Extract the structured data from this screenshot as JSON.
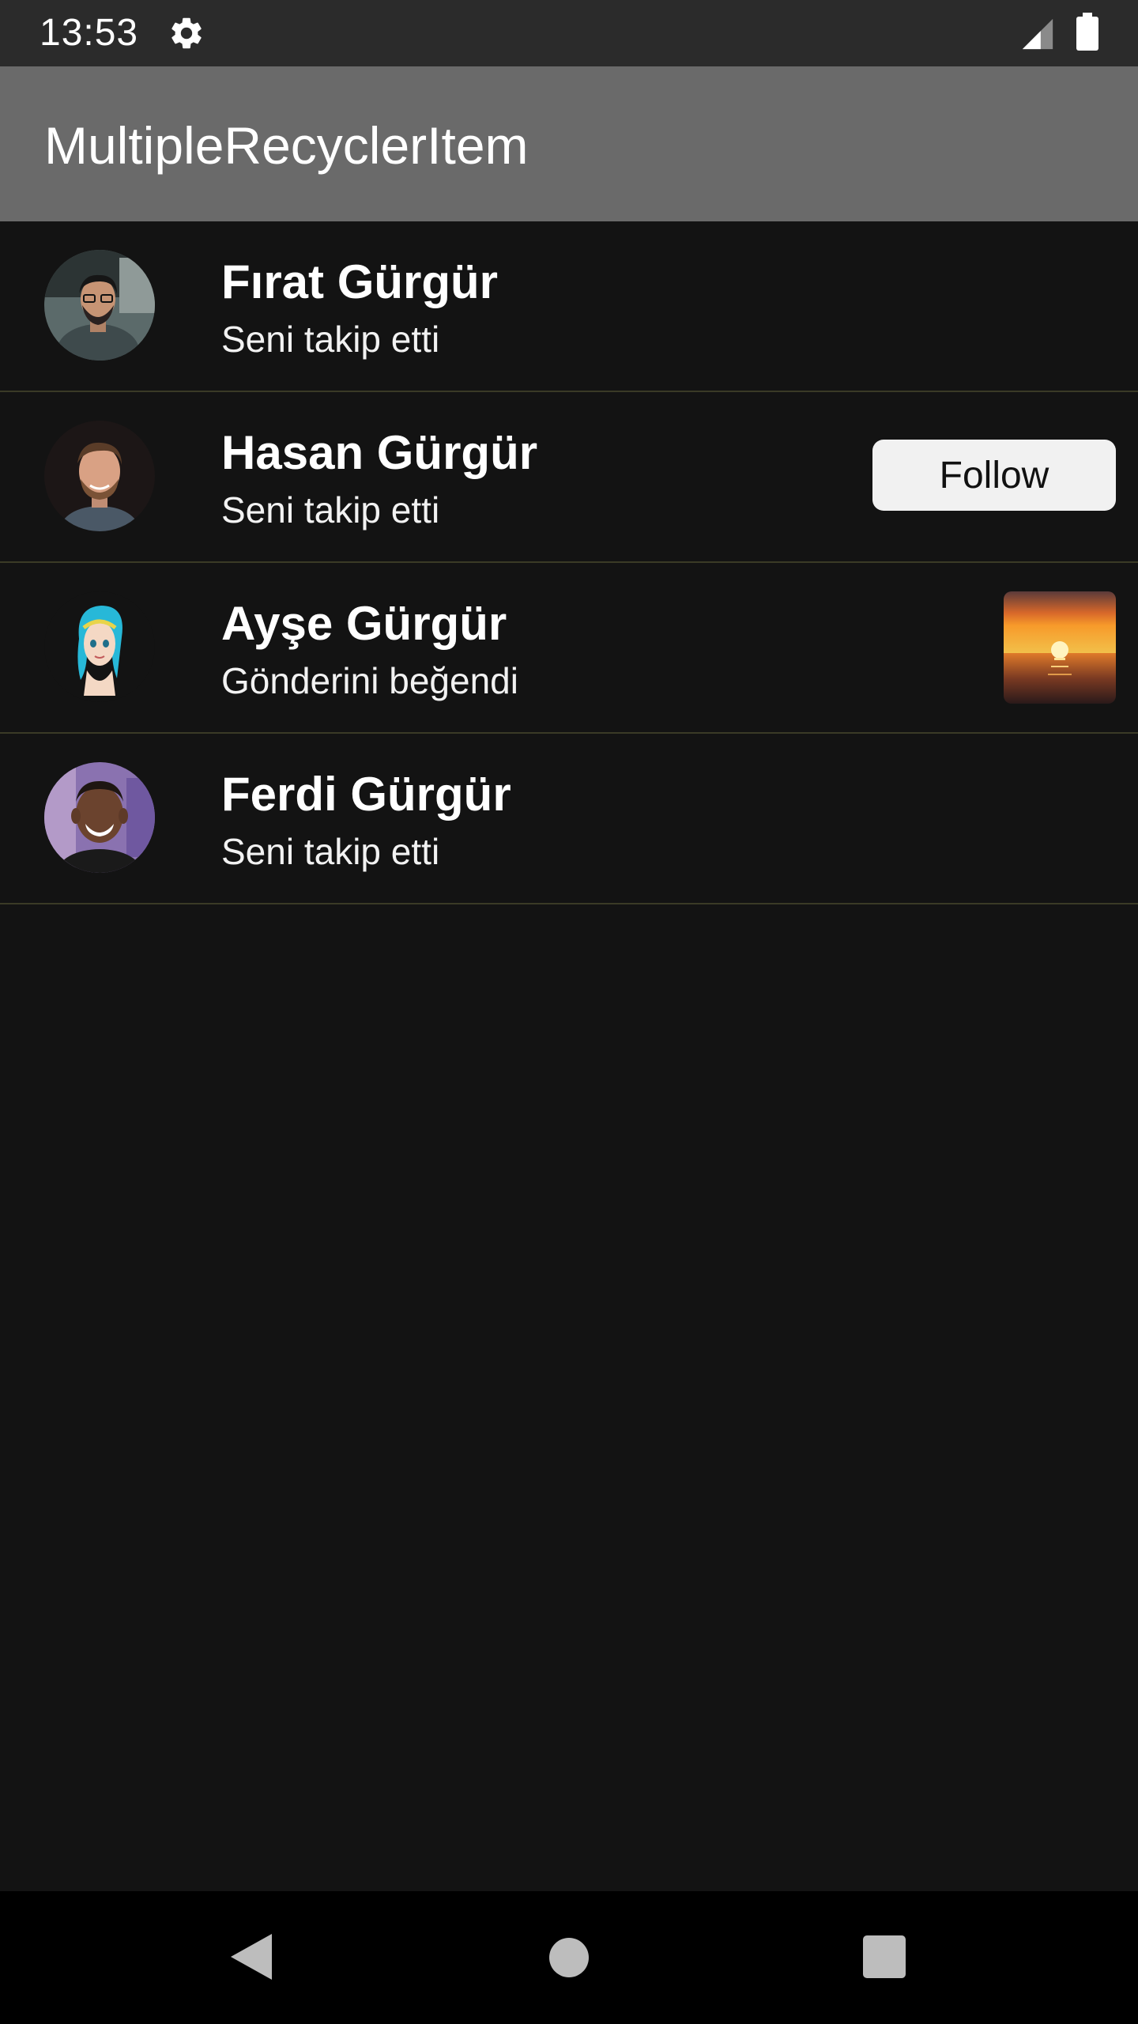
{
  "status_bar": {
    "time": "13:53",
    "icons": [
      "gear-icon",
      "signal-icon",
      "battery-icon"
    ]
  },
  "app_bar": {
    "title": "MultipleRecyclerItem"
  },
  "list": {
    "items": [
      {
        "name": "Fırat Gürgür",
        "subtitle": "Seni takip etti",
        "avatar": "avatar-man-glasses",
        "action": null
      },
      {
        "name": "Hasan Gürgür",
        "subtitle": "Seni takip etti",
        "avatar": "avatar-man-beard",
        "action": "Follow"
      },
      {
        "name": "Ayşe Gürgür",
        "subtitle": "Gönderini beğendi",
        "avatar": "avatar-cartoon-girl",
        "action": "post-thumbnail-sunset"
      },
      {
        "name": "Ferdi Gürgür",
        "subtitle": "Seni takip etti",
        "avatar": "avatar-man-smiling",
        "action": null
      }
    ]
  },
  "nav_bar": {
    "icons": [
      "back-icon",
      "home-icon",
      "recents-icon"
    ]
  },
  "colors": {
    "background": "#131313",
    "status_bar": "#2b2b2b",
    "app_bar": "#6a6a6a",
    "nav_bar": "#000000",
    "divider": "#3a3a26",
    "follow_button": "#f1f1f1"
  }
}
